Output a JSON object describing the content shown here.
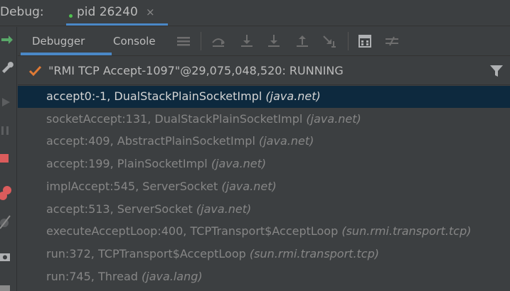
{
  "topbar": {
    "debug_label": "Debug:",
    "session_name": "pid 26240",
    "close_glyph": "×"
  },
  "subtabs": {
    "debugger": "Debugger",
    "console": "Console"
  },
  "thread": {
    "text": "\"RMI TCP Accept-1097\"@29,075,048,520: RUNNING"
  },
  "frames": [
    {
      "method": "accept0:-1, DualStackPlainSocketImpl",
      "pkg": "(java.net)",
      "selected": true
    },
    {
      "method": "socketAccept:131, DualStackPlainSocketImpl",
      "pkg": "(java.net)"
    },
    {
      "method": "accept:409, AbstractPlainSocketImpl",
      "pkg": "(java.net)"
    },
    {
      "method": "accept:199, PlainSocketImpl",
      "pkg": "(java.net)"
    },
    {
      "method": "implAccept:545, ServerSocket",
      "pkg": "(java.net)"
    },
    {
      "method": "accept:513, ServerSocket",
      "pkg": "(java.net)"
    },
    {
      "method": "executeAcceptLoop:400, TCPTransport$AcceptLoop",
      "pkg": "(sun.rmi.transport.tcp)"
    },
    {
      "method": "run:372, TCPTransport$AcceptLoop",
      "pkg": "(sun.rmi.transport.tcp)"
    },
    {
      "method": "run:745, Thread",
      "pkg": "(java.lang)"
    }
  ],
  "colors": {
    "background": "#3c3f41",
    "selected_row": "#0d293e",
    "accent_tab": "#4a88c7",
    "running_check": "#e07a35",
    "session_dot": "#4fc14f",
    "frame_text": "#868686"
  },
  "icons": {
    "rerun": "rerun-icon",
    "settings": "wrench-icon",
    "resume": "resume-icon",
    "pause": "pause-icon",
    "stop": "stop-icon",
    "breakpoints": "view-breakpoints-icon",
    "mute": "mute-breakpoints-icon",
    "camera": "camera-icon",
    "layout": "layout-icon",
    "step_over": "step-over-icon",
    "step_into": "step-into-icon",
    "force_step_into": "force-step-into-icon",
    "step_out": "step-out-icon",
    "run_to_cursor": "run-to-cursor-icon",
    "evaluate": "evaluate-expression-icon",
    "trace": "trace-icon",
    "check": "check-icon",
    "filter": "filter-icon"
  }
}
